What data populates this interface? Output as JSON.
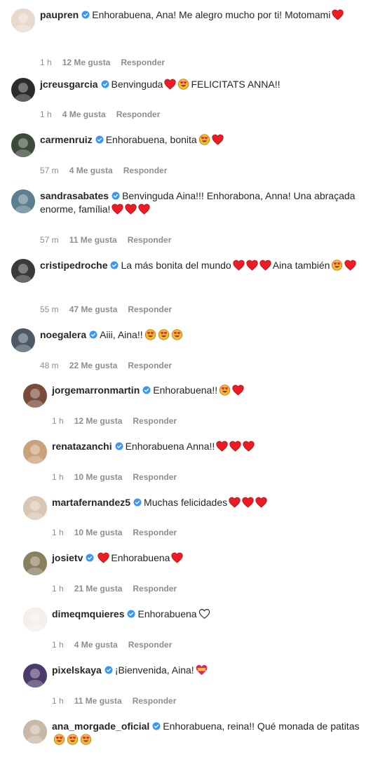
{
  "comments": [
    {
      "username": "paupren",
      "text": "Enhorabuena, Ana! Me alegro mucho por ti! Motomami",
      "emojis_after": [
        "red-heart"
      ],
      "time": "1 h",
      "likes": "12 Me gusta",
      "reply_label": "Responder",
      "avatar_color": "#e8d9cc"
    },
    {
      "username": "jcreusgarcia",
      "text": "Benvinguda",
      "emojis_after": [
        "red-heart",
        "heart-eyes"
      ],
      "text2": "FELICITATS ANNA!!",
      "time": "1 h",
      "likes": "4 Me gusta",
      "reply_label": "Responder",
      "avatar_color": "#2b2b2b"
    },
    {
      "username": "carmenruiz",
      "text": "Enhorabuena, bonita",
      "emojis_after": [
        "heart-eyes",
        "red-heart"
      ],
      "time": "57 m",
      "likes": "4 Me gusta",
      "reply_label": "Responder",
      "avatar_color": "#3c4a3a"
    },
    {
      "username": "sandrasabates",
      "text": "Benvinguda Aina!!! Enhorabona, Anna! Una abraçada enorme, família!",
      "emojis_after": [
        "red-heart",
        "red-heart",
        "red-heart"
      ],
      "time": "57 m",
      "likes": "11 Me gusta",
      "reply_label": "Responder",
      "avatar_color": "#5b7f8f"
    },
    {
      "username": "cristipedroche",
      "text": "La más bonita del mundo",
      "emojis_after": [
        "red-heart",
        "red-heart",
        "red-heart"
      ],
      "text2": "Aina también",
      "emojis_after2": [
        "heart-eyes",
        "red-heart"
      ],
      "time": "55 m",
      "likes": "47 Me gusta",
      "reply_label": "Responder",
      "avatar_color": "#3a3a3a"
    },
    {
      "username": "noegalera",
      "text": "Aiii, Aina!!",
      "emojis_after": [
        "heart-eyes",
        "heart-eyes",
        "heart-eyes"
      ],
      "time": "48 m",
      "likes": "22 Me gusta",
      "reply_label": "Responder",
      "avatar_color": "#4d5a66"
    },
    {
      "username": "jorgemarronmartin",
      "text": "Enhorabuena!!",
      "emojis_after": [
        "heart-eyes",
        "red-heart"
      ],
      "time": "1 h",
      "likes": "12 Me gusta",
      "reply_label": "Responder",
      "avatar_color": "#7a4b3a"
    },
    {
      "username": "renatazanchi",
      "text": "Enhorabuena Anna!!",
      "emojis_after": [
        "red-heart",
        "red-heart",
        "red-heart"
      ],
      "time": "1 h",
      "likes": "10 Me gusta",
      "reply_label": "Responder",
      "avatar_color": "#c9a27a"
    },
    {
      "username": "martafernandez5",
      "text": "Muchas felicidades",
      "emojis_after": [
        "red-heart",
        "red-heart",
        "red-heart"
      ],
      "time": "1 h",
      "likes": "10 Me gusta",
      "reply_label": "Responder",
      "avatar_color": "#d9c7b3"
    },
    {
      "username": "josietv",
      "text": "",
      "emojis_after": [
        "red-heart"
      ],
      "text2": "Enhorabuena",
      "emojis_after2": [
        "red-heart"
      ],
      "time": "1 h",
      "likes": "21 Me gusta",
      "reply_label": "Responder",
      "avatar_color": "#8a8060"
    },
    {
      "username": "dimeqmquieres",
      "text": "Enhorabuena",
      "emojis_after": [
        "white-heart"
      ],
      "time": "1 h",
      "likes": "4 Me gusta",
      "reply_label": "Responder",
      "avatar_color": "#f4efe8"
    },
    {
      "username": "pixelskaya",
      "text": "¡Bienvenida, Aina!",
      "emojis_after": [
        "heart-ribbon"
      ],
      "time": "1 h",
      "likes": "11 Me gusta",
      "reply_label": "Responder",
      "avatar_color": "#4b3a6a"
    },
    {
      "username": "ana_morgade_oficial",
      "text": "Enhorabuena, reina!! Qué monada de patitas",
      "emojis_after": [
        "heart-eyes",
        "heart-eyes",
        "heart-eyes"
      ],
      "time": "",
      "likes": "",
      "reply_label": "",
      "avatar_color": "#c8b8a6"
    }
  ],
  "colors": {
    "verified": "#3897f0",
    "meta": "#8e8e8e",
    "heart": "#ed1c24"
  }
}
